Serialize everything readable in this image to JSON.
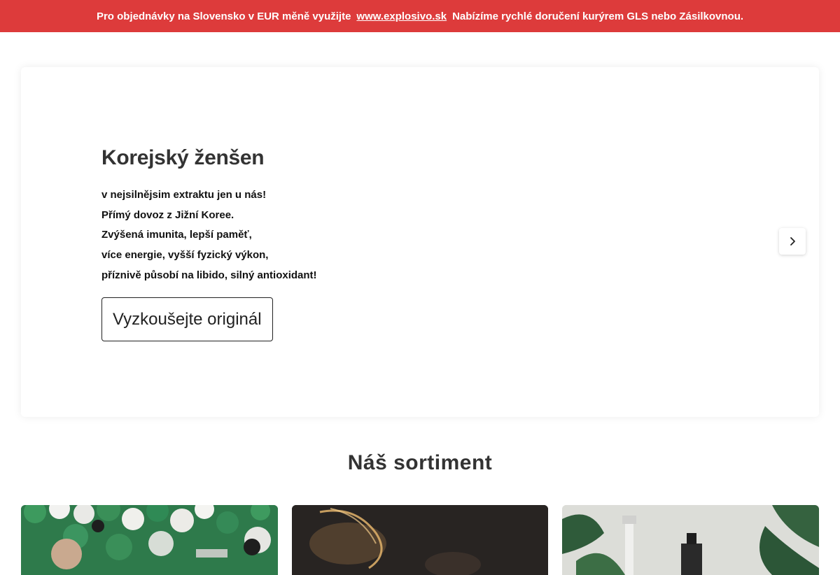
{
  "announcement": {
    "text_before": "Pro objednávky na Slovensko v EUR měně využijte",
    "link_text": "www.explosivo.sk",
    "text_after": "Nabízíme rychlé doručení kurýrem GLS nebo Zásilkovnou."
  },
  "hero": {
    "title": "Korejský ženšen",
    "lines": [
      "v nejsilnějsim extraktu jen u nás!",
      "Přímý dovoz z Jižní Koree.",
      "Zvýšená imunita, lepší paměť,",
      "více energie, vyšší fyzický výkon,",
      "příznivě působí na libido, silný antioxidant!"
    ],
    "cta_label": "Vyzkoušejte originál",
    "next_icon": "chevron-right-icon"
  },
  "assortment": {
    "title": "Náš sortiment"
  },
  "colors": {
    "announcement_bg": "#dd3b3b",
    "text_dark": "#333333"
  }
}
